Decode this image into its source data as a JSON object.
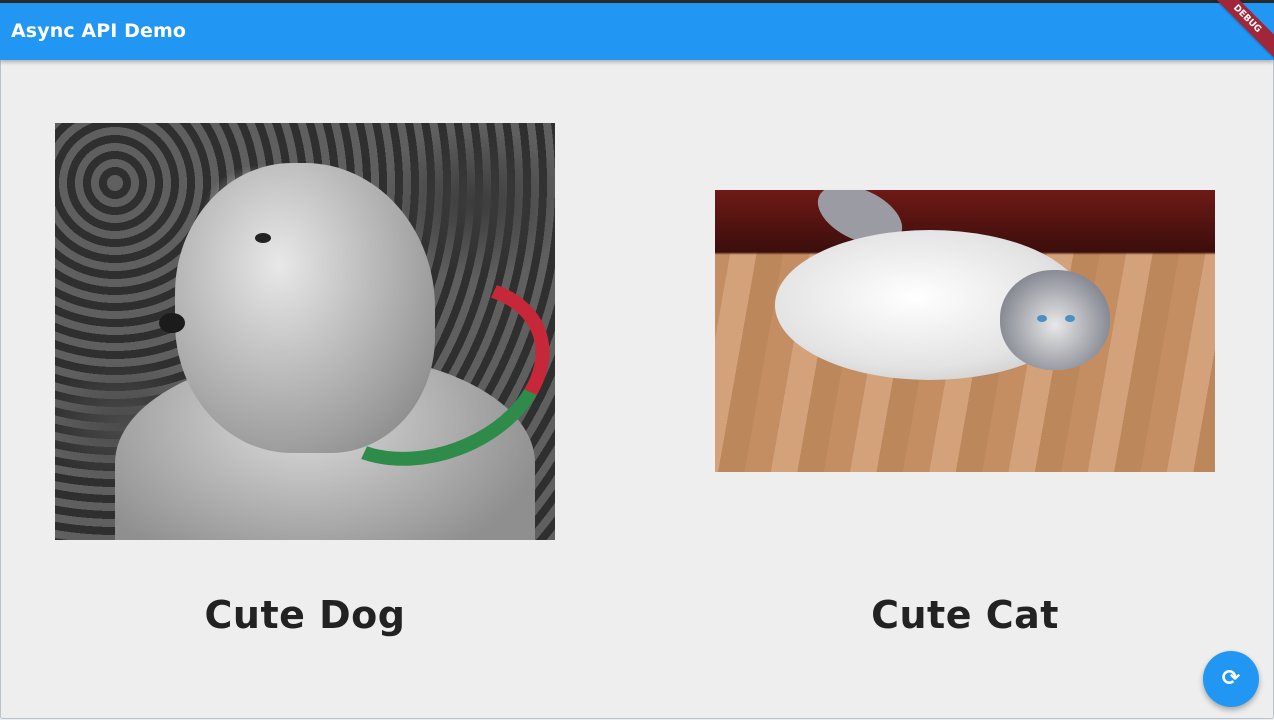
{
  "app": {
    "title": "Async API Demo",
    "debug_banner": "DEBUG",
    "accent_color": "#2196f3"
  },
  "cards": [
    {
      "image_icon": "dog-photo",
      "label": "Cute Dog"
    },
    {
      "image_icon": "cat-photo",
      "label": "Cute Cat"
    }
  ],
  "fab": {
    "icon": "refresh-icon",
    "glyph": "⟳"
  }
}
